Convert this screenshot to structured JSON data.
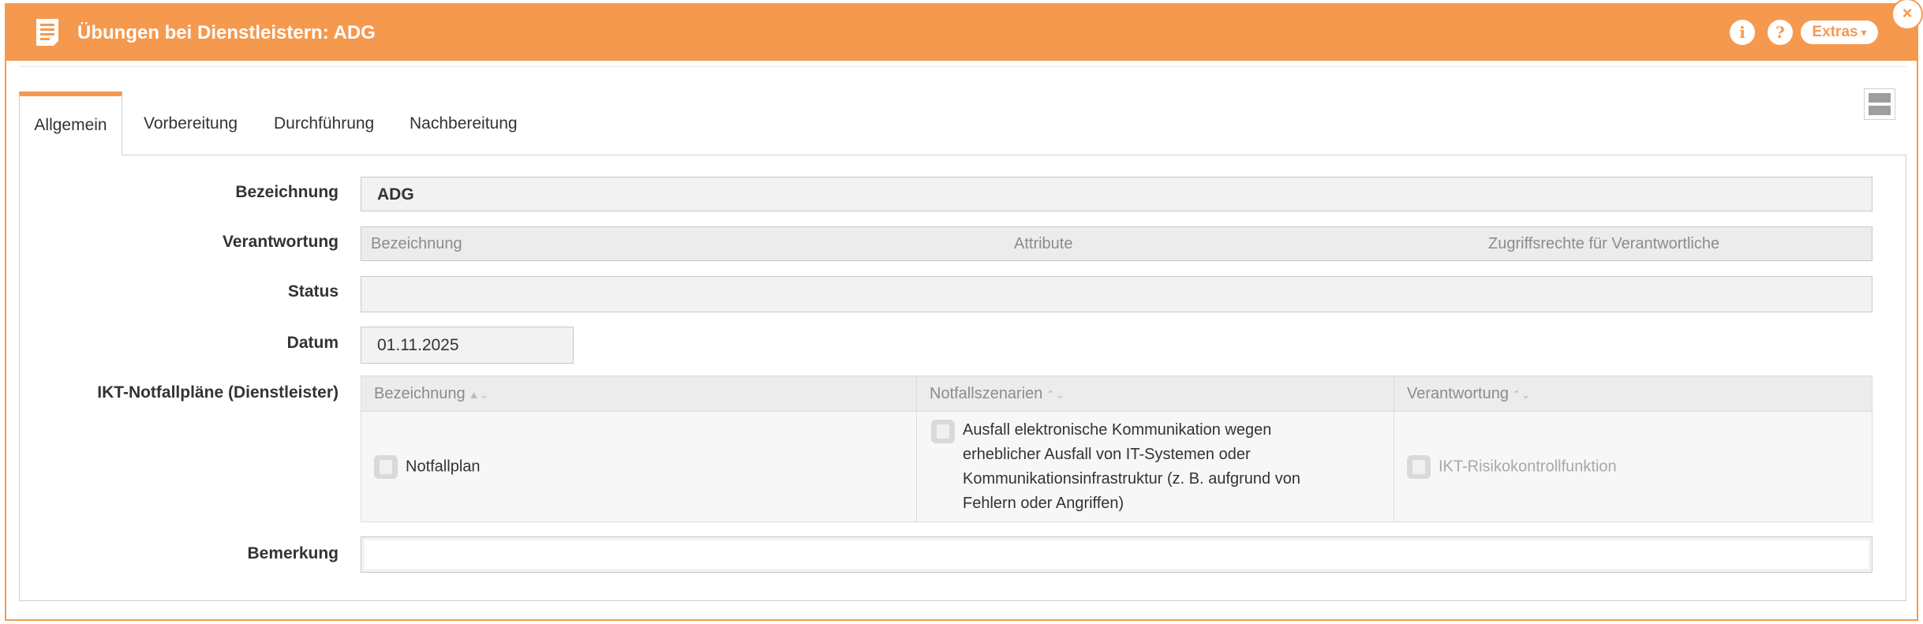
{
  "window": {
    "title": "Übungen bei Dienstleistern: ADG",
    "info_icon": "info-icon",
    "help_icon": "help-icon",
    "extras_label": "Extras",
    "close_icon": "close-icon",
    "accent_color": "#f5994f"
  },
  "tabs": [
    {
      "label": "Allgemein",
      "active": true
    },
    {
      "label": "Vorbereitung",
      "active": false
    },
    {
      "label": "Durchführung",
      "active": false
    },
    {
      "label": "Nachbereitung",
      "active": false
    }
  ],
  "form": {
    "bezeichnung": {
      "label": "Bezeichnung",
      "value": "ADG"
    },
    "verantwortung": {
      "label": "Verantwortung",
      "columns": [
        "Bezeichnung",
        "Attribute",
        "Zugriffsrechte für Verantwortliche"
      ]
    },
    "status": {
      "label": "Status",
      "value": ""
    },
    "datum": {
      "label": "Datum",
      "value": "01.11.2025"
    },
    "ikt": {
      "label": "IKT-Notfallpläne (Dienstleister)",
      "columns": [
        "Bezeichnung",
        "Notfallszenarien",
        "Verantwortung"
      ],
      "rows": [
        {
          "bezeichnung": "Notfallplan",
          "notfallszenarien": "Ausfall elektronische Kommunikation wegen erheblicher Ausfall von IT-Systemen oder Kommunikationsinfrastruktur (z. B. aufgrund von Fehlern oder Angriffen)",
          "verantwortung": "IKT-Risikokontrollfunktion"
        }
      ]
    },
    "bemerkung": {
      "label": "Bemerkung",
      "value": ""
    }
  }
}
